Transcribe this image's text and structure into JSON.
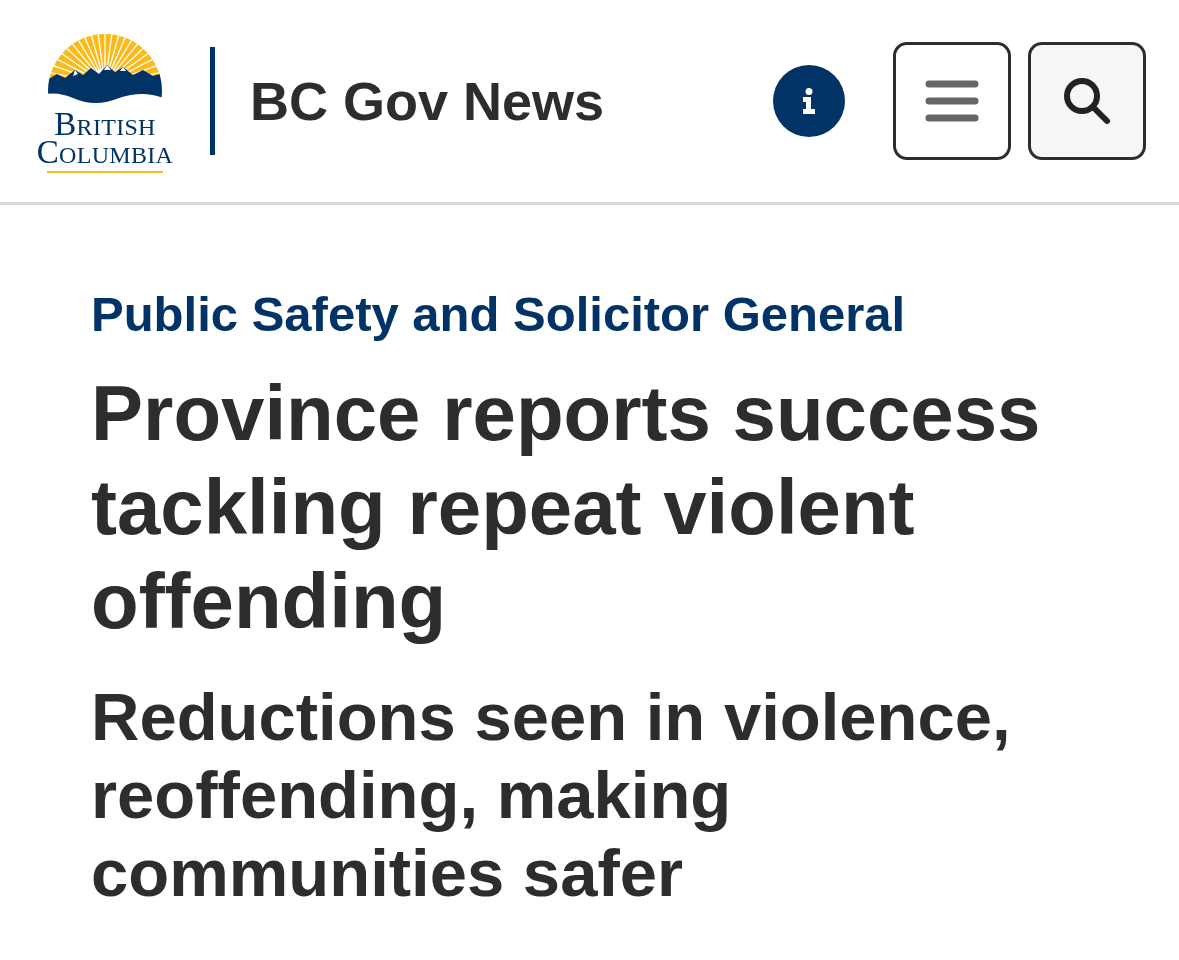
{
  "header": {
    "logo": {
      "lines": [
        "BRITISH",
        "COLUMBIA"
      ]
    },
    "site_title": "BC Gov News",
    "controls": [
      {
        "kind": "info"
      },
      {
        "kind": "menu"
      },
      {
        "kind": "search"
      }
    ]
  },
  "article": {
    "ministry": "Public Safety and Solicitor General",
    "title": "Province reports success tackling repeat violent offending",
    "subtitle": "Reductions seen in violence, reoffending, making communities safer"
  }
}
